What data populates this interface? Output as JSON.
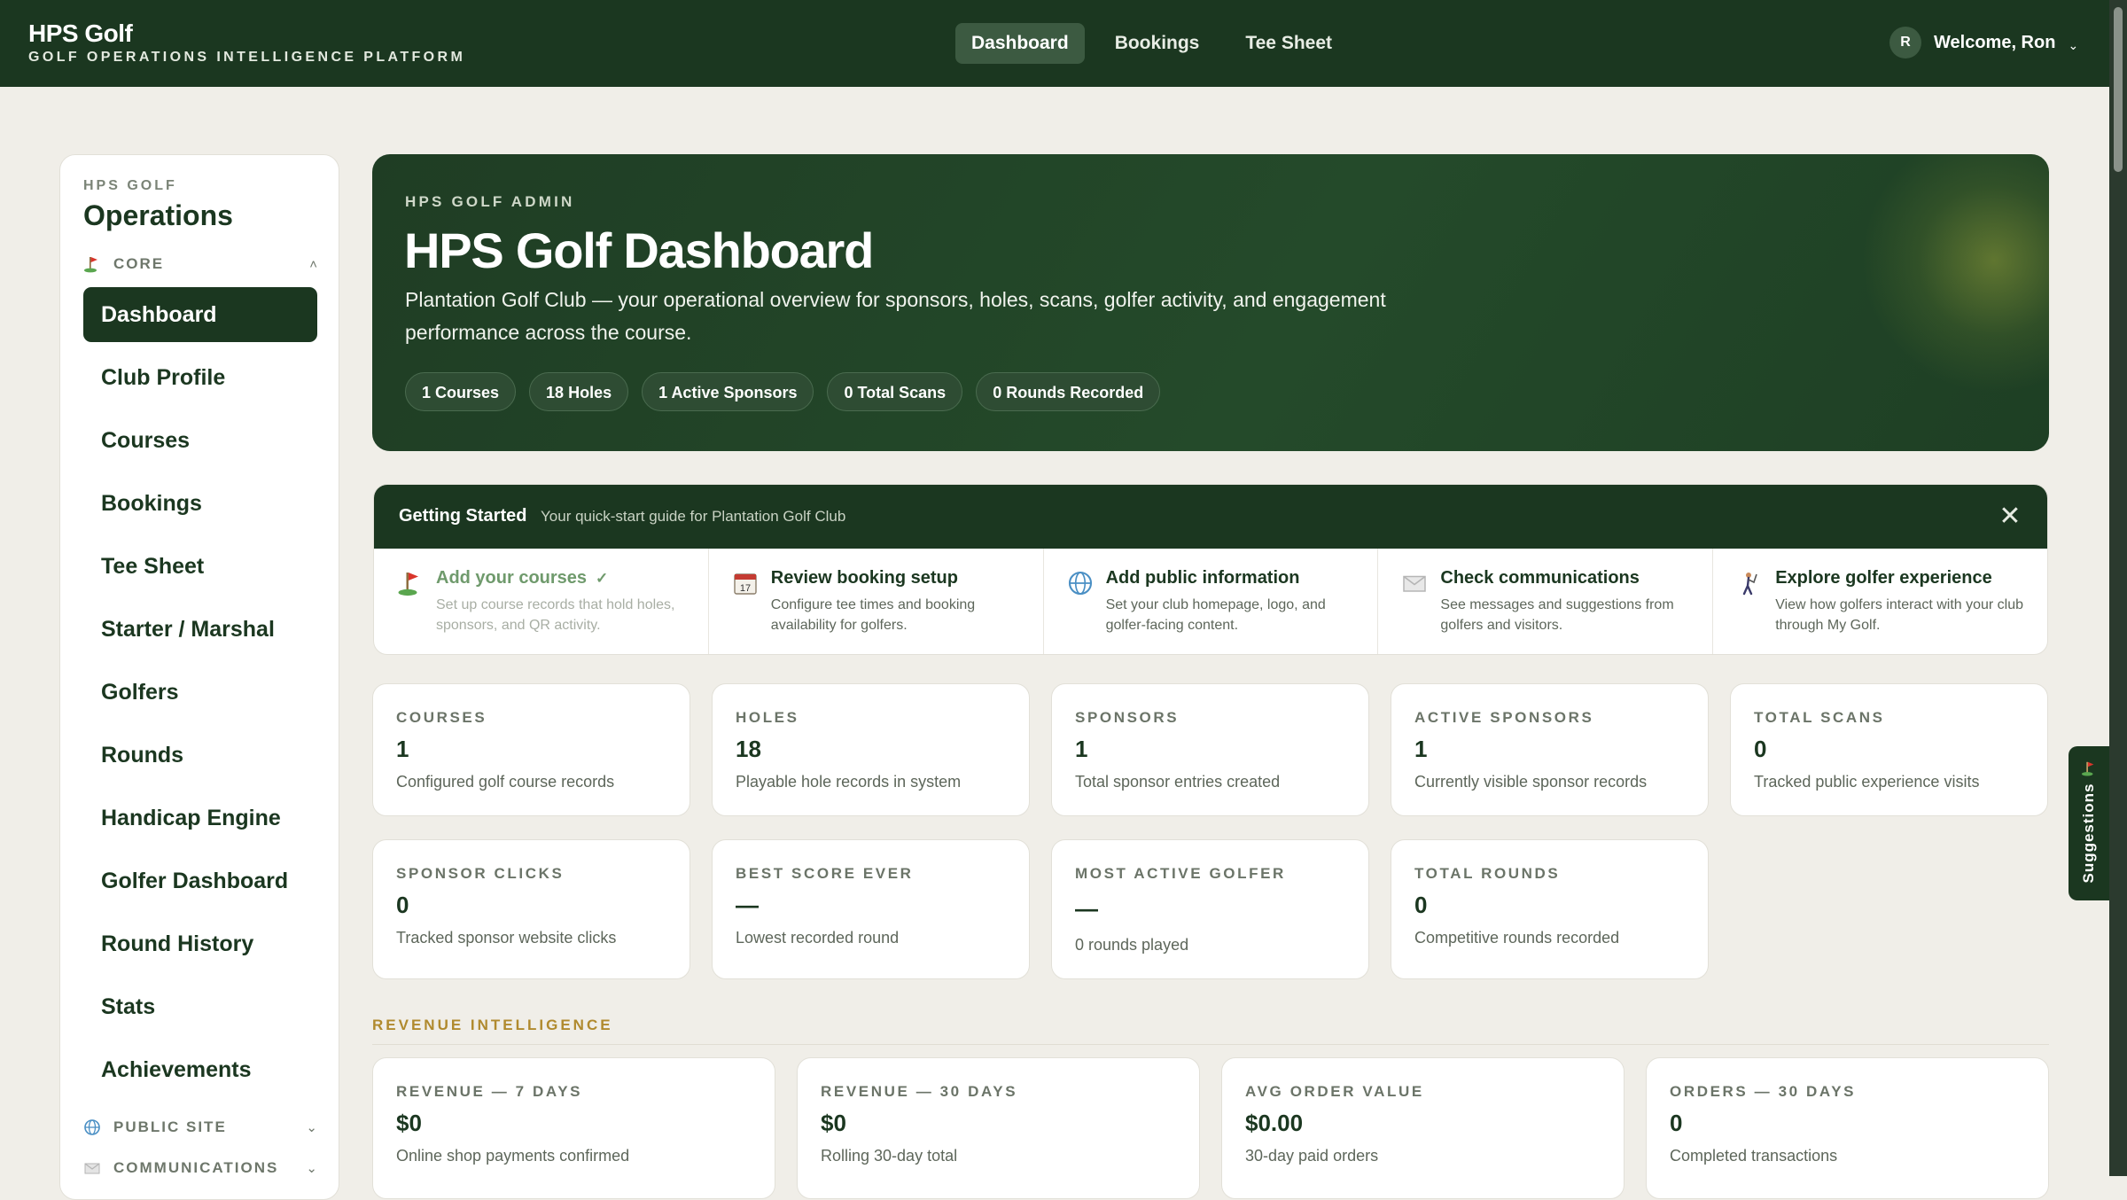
{
  "topnav": {
    "brand_title": "HPS Golf",
    "brand_subtitle": "GOLF OPERATIONS INTELLIGENCE PLATFORM",
    "links": [
      "Dashboard",
      "Bookings",
      "Tee Sheet"
    ],
    "active_link": "Dashboard",
    "user_initial": "R",
    "user_greeting": "Welcome, Ron",
    "caret": "⌄"
  },
  "sidebar": {
    "kicker": "HPS GOLF",
    "title": "Operations",
    "core_label": "CORE",
    "core_caret": "˄",
    "items": [
      "Dashboard",
      "Club Profile",
      "Courses",
      "Bookings",
      "Tee Sheet",
      "Starter / Marshal",
      "Golfers",
      "Rounds",
      "Handicap Engine",
      "Golfer Dashboard",
      "Round History",
      "Stats",
      "Achievements"
    ],
    "active_item": "Dashboard",
    "public_site_label": "PUBLIC SITE",
    "communications_label": "COMMUNICATIONS",
    "collapsed_caret": "⌄"
  },
  "hero": {
    "kicker": "HPS GOLF ADMIN",
    "title": "HPS Golf Dashboard",
    "description": "Plantation Golf Club — your operational overview for sponsors, holes, scans, golfer activity, and engagement performance across the course.",
    "pills": [
      "1 Courses",
      "18 Holes",
      "1 Active Sponsors",
      "0 Total Scans",
      "0 Rounds Recorded"
    ]
  },
  "getting_started": {
    "title": "Getting Started",
    "subtitle": "Your quick-start guide for Plantation Golf Club",
    "close": "✕",
    "check": "✓",
    "steps": [
      {
        "icon": "flag-icon",
        "title": "Add your courses",
        "desc": "Set up course records that hold holes, sponsors, and QR activity.",
        "done": true
      },
      {
        "icon": "calendar-icon",
        "title": "Review booking setup",
        "desc": "Configure tee times and booking availability for golfers.",
        "done": false
      },
      {
        "icon": "globe-icon",
        "title": "Add public information",
        "desc": "Set your club homepage, logo, and golfer-facing content.",
        "done": false
      },
      {
        "icon": "envelope-icon",
        "title": "Check communications",
        "desc": "See messages and suggestions from golfers and visitors.",
        "done": false
      },
      {
        "icon": "golfer-icon",
        "title": "Explore golfer experience",
        "desc": "View how golfers interact with your club through My Golf.",
        "done": false
      }
    ]
  },
  "stats": [
    {
      "label": "COURSES",
      "value": "1",
      "desc": "Configured golf course records"
    },
    {
      "label": "HOLES",
      "value": "18",
      "desc": "Playable hole records in system"
    },
    {
      "label": "SPONSORS",
      "value": "1",
      "desc": "Total sponsor entries created"
    },
    {
      "label": "ACTIVE SPONSORS",
      "value": "1",
      "desc": "Currently visible sponsor records"
    },
    {
      "label": "TOTAL SCANS",
      "value": "0",
      "desc": "Tracked public experience visits"
    },
    {
      "label": "SPONSOR CLICKS",
      "value": "0",
      "desc": "Tracked sponsor website clicks"
    },
    {
      "label": "BEST SCORE EVER",
      "value": "—",
      "desc": "Lowest recorded round"
    },
    {
      "label": "MOST ACTIVE GOLFER",
      "value": "—",
      "desc": "0 rounds played"
    },
    {
      "label": "TOTAL ROUNDS",
      "value": "0",
      "desc": "Competitive rounds recorded"
    }
  ],
  "revenue": {
    "heading": "REVENUE INTELLIGENCE",
    "cards": [
      {
        "label": "REVENUE — 7 DAYS",
        "value": "$0",
        "desc": "Online shop payments confirmed"
      },
      {
        "label": "REVENUE — 30 DAYS",
        "value": "$0",
        "desc": "Rolling 30-day total"
      },
      {
        "label": "AVG ORDER VALUE",
        "value": "$0.00",
        "desc": "30-day paid orders"
      },
      {
        "label": "ORDERS — 30 DAYS",
        "value": "0",
        "desc": "Completed transactions"
      }
    ]
  },
  "suggestions": {
    "label": "Suggestions"
  },
  "colors": {
    "brand_green": "#1b3720",
    "accent_gold": "#b08a2e",
    "background": "#f0eee8"
  }
}
